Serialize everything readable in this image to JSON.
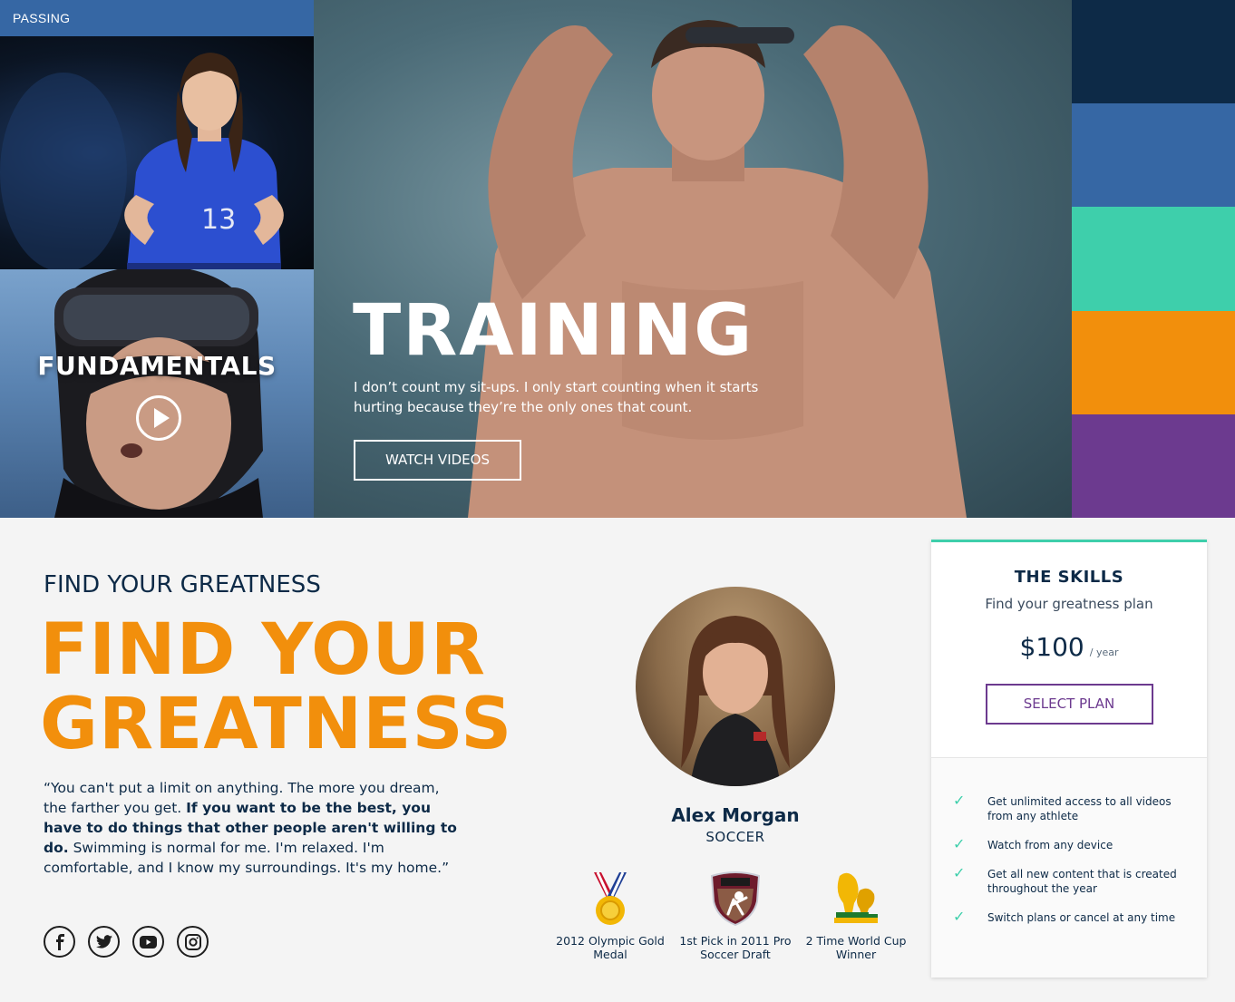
{
  "left": {
    "category_label": "PASSING",
    "card_title": "FUNDAMENTALS"
  },
  "hero": {
    "title": "TRAINING",
    "text": "I don’t count my sit-ups. I only start counting when it starts hurting because they’re the only ones that count.",
    "button_label": "WATCH VIDEOS"
  },
  "swatches": {
    "colors": [
      "#0d2a47",
      "#3667a4",
      "#3ecfab",
      "#f28f0c",
      "#6c3a8f"
    ]
  },
  "main": {
    "eyebrow": "FIND YOUR GREATNESS",
    "headline": "FIND YOUR GREATNESS",
    "quote_start": "“You can't put a limit on anything. The more you dream, the farther you get.",
    "quote_bold": "If you want to be the best, you have to do things that other people aren't willing to do.",
    "quote_end": "Swimming is normal for me. I'm relaxed. I'm comfortable, and I know my surroundings. It's my home.”",
    "socials": [
      "facebook-icon",
      "twitter-icon",
      "youtube-icon",
      "instagram-icon"
    ]
  },
  "athlete": {
    "name": "Alex Morgan",
    "sport": "SOCCER",
    "awards": [
      {
        "icon": "gold-medal-icon",
        "label": "2012 Olympic Gold Medal"
      },
      {
        "icon": "wps-badge-icon",
        "label": "1st Pick in 2011 Pro Soccer Draft"
      },
      {
        "icon": "world-cup-trophy-icon",
        "label": "2 Time World Cup Winner"
      }
    ]
  },
  "plan": {
    "title": "THE SKILLS",
    "subtitle": "Find your greatness plan",
    "price": "$100",
    "period": "/ year",
    "button_label": "SELECT PLAN",
    "features": [
      "Get unlimited access to all videos from any athlete",
      "Watch from any device",
      "Get all new content that is created throughout the year",
      "Switch plans or cancel at any time"
    ]
  }
}
